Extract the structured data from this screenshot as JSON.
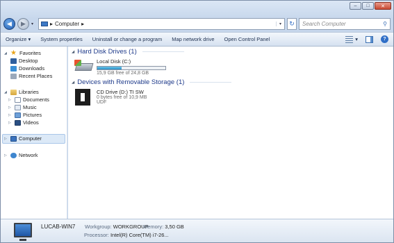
{
  "window": {
    "controls": {
      "minimize": "–",
      "maximize": "□",
      "close": "✕"
    }
  },
  "address": {
    "back_glyph": "◀",
    "forward_glyph": "▶",
    "sep": "▸",
    "crumb": "Computer",
    "sep2": "▸",
    "refresh_glyph": "↻",
    "search_placeholder": "Search Computer",
    "search_glyph": "⚲"
  },
  "toolbar": {
    "organize": "Organize ▾",
    "system_properties": "System properties",
    "uninstall": "Uninstall or change a program",
    "map_drive": "Map network drive",
    "control_panel": "Open Control Panel",
    "view_caret": "▾",
    "help": "?"
  },
  "nav": {
    "favorites": "Favorites",
    "desktop": "Desktop",
    "downloads": "Downloads",
    "recent": "Recent Places",
    "libraries": "Libraries",
    "documents": "Documents",
    "music": "Music",
    "pictures": "Pictures",
    "videos": "Videos",
    "computer": "Computer",
    "network": "Network",
    "star_glyph": "★",
    "open_tri": "◢",
    "closed_tri": "▷"
  },
  "groups": {
    "hdd_title": "Hard Disk Drives (1)",
    "removable_title": "Devices with Removable Storage (1)",
    "tri": "◢"
  },
  "drives": {
    "local": {
      "name": "Local Disk (C:)",
      "space": "15,9 GB free of 24,8 GB",
      "used_fraction": 0.36
    },
    "cd": {
      "name": "CD Drive (D:) TI SW",
      "space": "0 bytes free of 10,9 MB",
      "fs": "UDF"
    }
  },
  "details": {
    "computer_name": "LUCAB-WIN7",
    "workgroup_label": "Workgroup:",
    "workgroup": "WORKGROUP",
    "memory_label": "Memory:",
    "memory": "3,50 GB",
    "processor_label": "Processor:",
    "processor": "Intel(R) Core(TM) i7-26..."
  }
}
